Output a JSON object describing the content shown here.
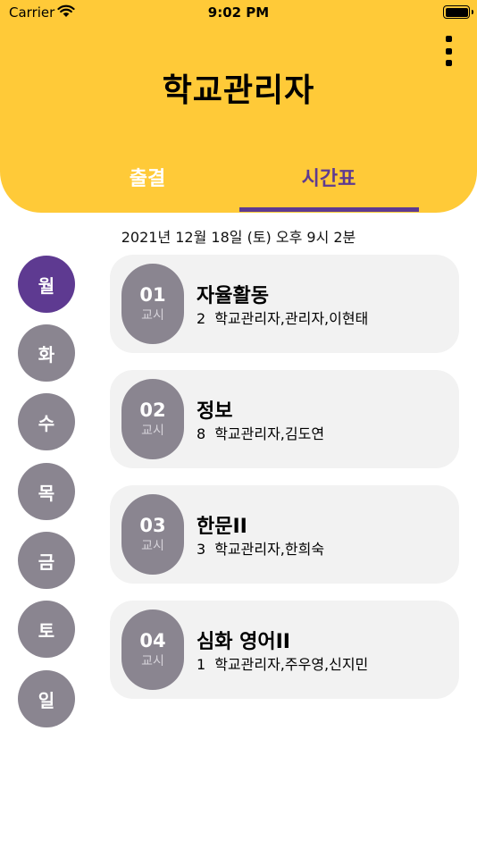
{
  "status_bar": {
    "carrier": "Carrier",
    "time": "9:02 PM"
  },
  "header": {
    "title": "학교관리자",
    "tabs": [
      {
        "label": "출결",
        "active": false
      },
      {
        "label": "시간표",
        "active": true
      }
    ]
  },
  "date_display": "2021년 12월 18일 (토) 오후 9시 2분",
  "days": [
    {
      "label": "월",
      "selected": true
    },
    {
      "label": "화",
      "selected": false
    },
    {
      "label": "수",
      "selected": false
    },
    {
      "label": "목",
      "selected": false
    },
    {
      "label": "금",
      "selected": false
    },
    {
      "label": "토",
      "selected": false
    },
    {
      "label": "일",
      "selected": false
    }
  ],
  "periods": [
    {
      "number": "01",
      "unit": "교시",
      "subject": "자율활동",
      "room": "2",
      "teachers": "학교관리자,관리자,이현태"
    },
    {
      "number": "02",
      "unit": "교시",
      "subject": "정보",
      "room": "8",
      "teachers": "학교관리자,김도연"
    },
    {
      "number": "03",
      "unit": "교시",
      "subject": "한문II",
      "room": "3",
      "teachers": "학교관리자,한희숙"
    },
    {
      "number": "04",
      "unit": "교시",
      "subject": "심화 영어II",
      "room": "1",
      "teachers": "학교관리자,주우영,신지민"
    }
  ],
  "colors": {
    "header": "#FFCA38",
    "accent": "#5E3A91",
    "badge": "#8A8590",
    "card": "#F2F2F2"
  }
}
